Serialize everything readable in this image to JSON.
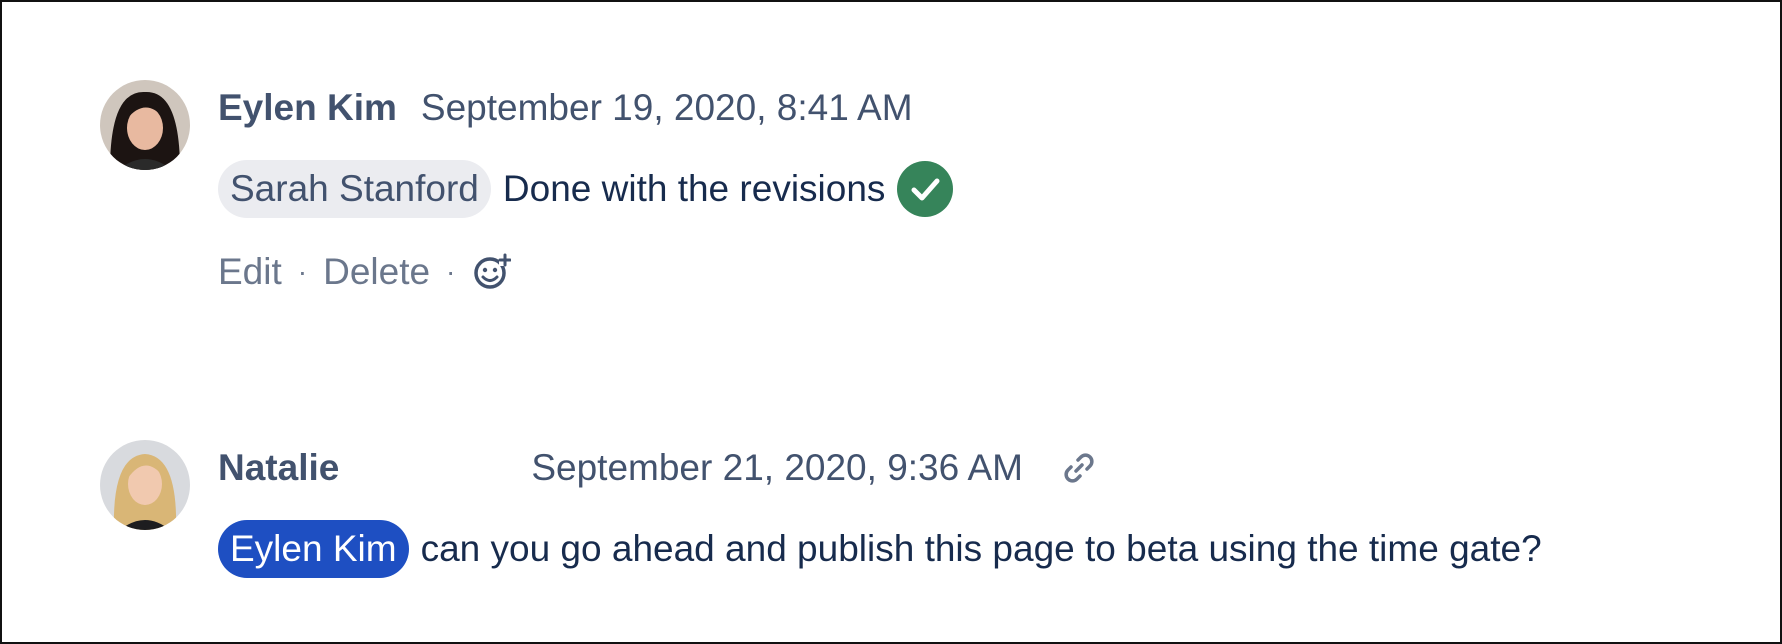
{
  "comments": [
    {
      "author": "Eylen Kim",
      "timestamp": "September 19, 2020, 8:41 AM",
      "mention": "Sarah Stanford",
      "text": "Done with the revisions",
      "status_icon": "check-circle-icon",
      "actions": {
        "edit": "Edit",
        "delete": "Delete",
        "separator": "·",
        "reaction_icon": "add-reaction-icon"
      }
    },
    {
      "author": "Natalie",
      "timestamp": "September 21, 2020, 9:36 AM",
      "permalink_icon": "link-icon",
      "mention": "Eylen Kim",
      "text": "can you go ahead and publish this page to beta using the time gate?"
    }
  ],
  "colors": {
    "mention_self_bg": "#1e4fc2",
    "mention_other_bg": "#ebecf0",
    "success": "#36845a",
    "text_primary": "#172b4d",
    "text_secondary": "#42526e",
    "text_subtle": "#6b778c"
  }
}
